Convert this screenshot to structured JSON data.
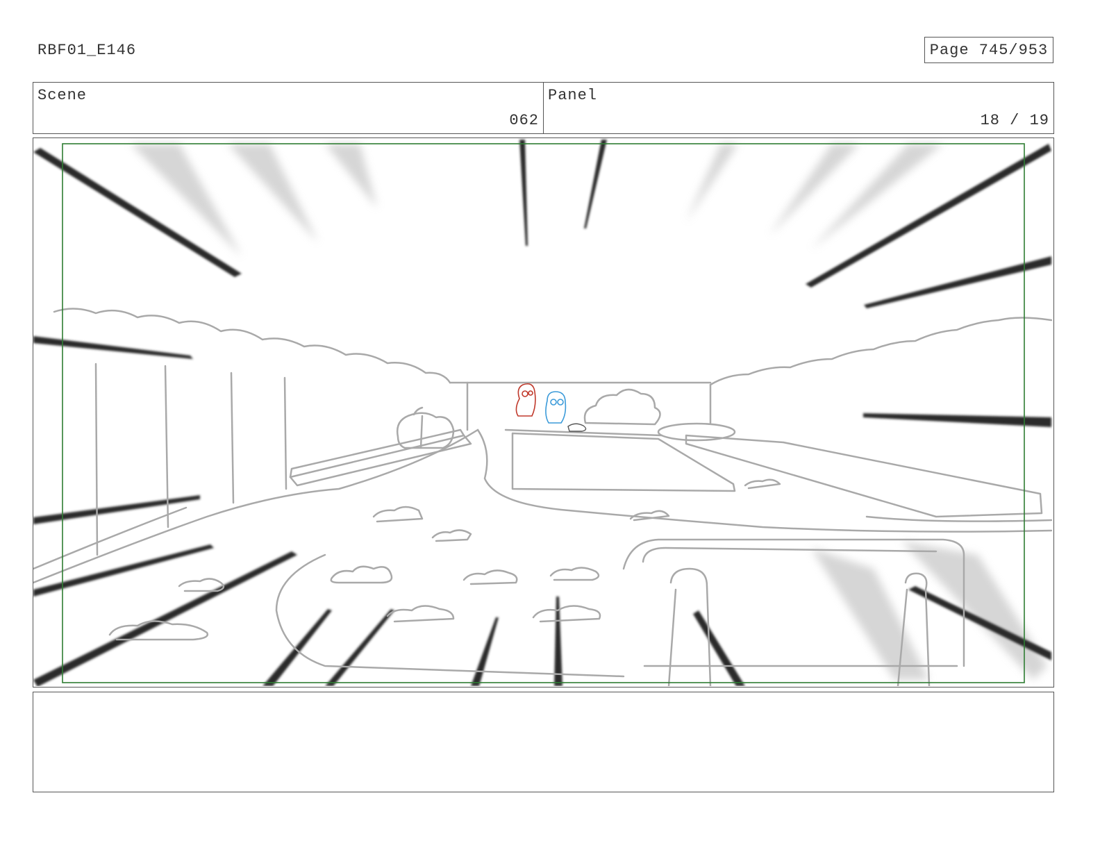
{
  "document": {
    "id": "RBF01_E146",
    "page_label": "Page 745/953"
  },
  "header": {
    "scene_label": "Scene",
    "scene_value": "062",
    "panel_label": "Panel",
    "panel_value": "18 / 19"
  },
  "colors": {
    "frame_border": "#555555",
    "safe_area": "#2e7d32",
    "sketch_line": "#a9a9a9",
    "speed_line": "#222222",
    "character_left": "#c0392b",
    "character_right": "#3a9ad9"
  },
  "notes": {
    "text": ""
  }
}
